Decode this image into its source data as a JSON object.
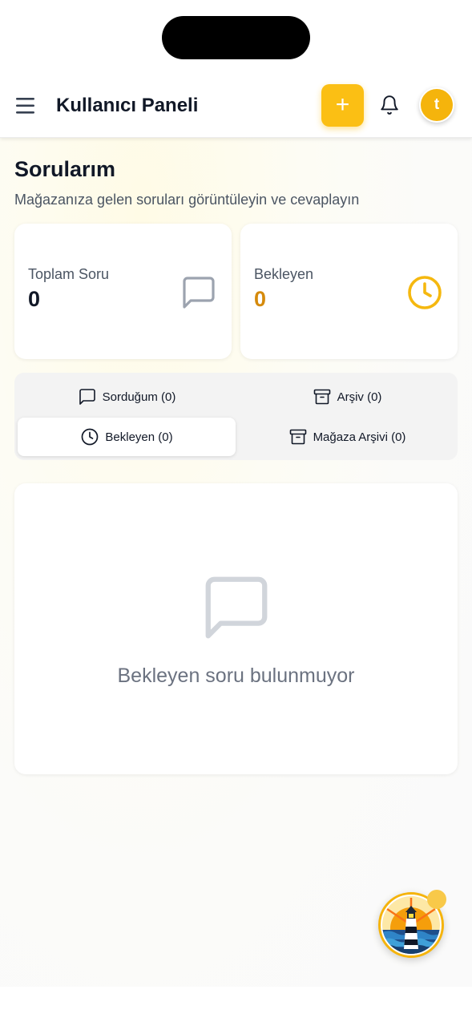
{
  "header": {
    "title": "Kullanıcı Paneli",
    "add_label": "+",
    "avatar_initial": "t"
  },
  "page": {
    "title": "Sorularım",
    "subtitle": "Mağazanıza gelen soruları görüntüleyin ve cevaplayın"
  },
  "stats": [
    {
      "label": "Toplam Soru",
      "value": "0",
      "icon": "message-square-icon"
    },
    {
      "label": "Bekleyen",
      "value": "0",
      "icon": "clock-icon",
      "color": "#d58a0c"
    }
  ],
  "tabs": [
    {
      "label": "Sorduğum (0)",
      "icon": "message-square-icon",
      "active": false
    },
    {
      "label": "Arşiv (0)",
      "icon": "archive-icon",
      "active": false
    },
    {
      "label": "Bekleyen (0)",
      "icon": "clock-icon",
      "active": true
    },
    {
      "label": "Mağaza Arşivi (0)",
      "icon": "archive-icon",
      "active": false
    }
  ],
  "empty_state": {
    "message": "Bekleyen soru bulunmuyor",
    "icon": "message-square-icon"
  },
  "colors": {
    "accent": "#fbbf14",
    "pending": "#d58a0c"
  }
}
